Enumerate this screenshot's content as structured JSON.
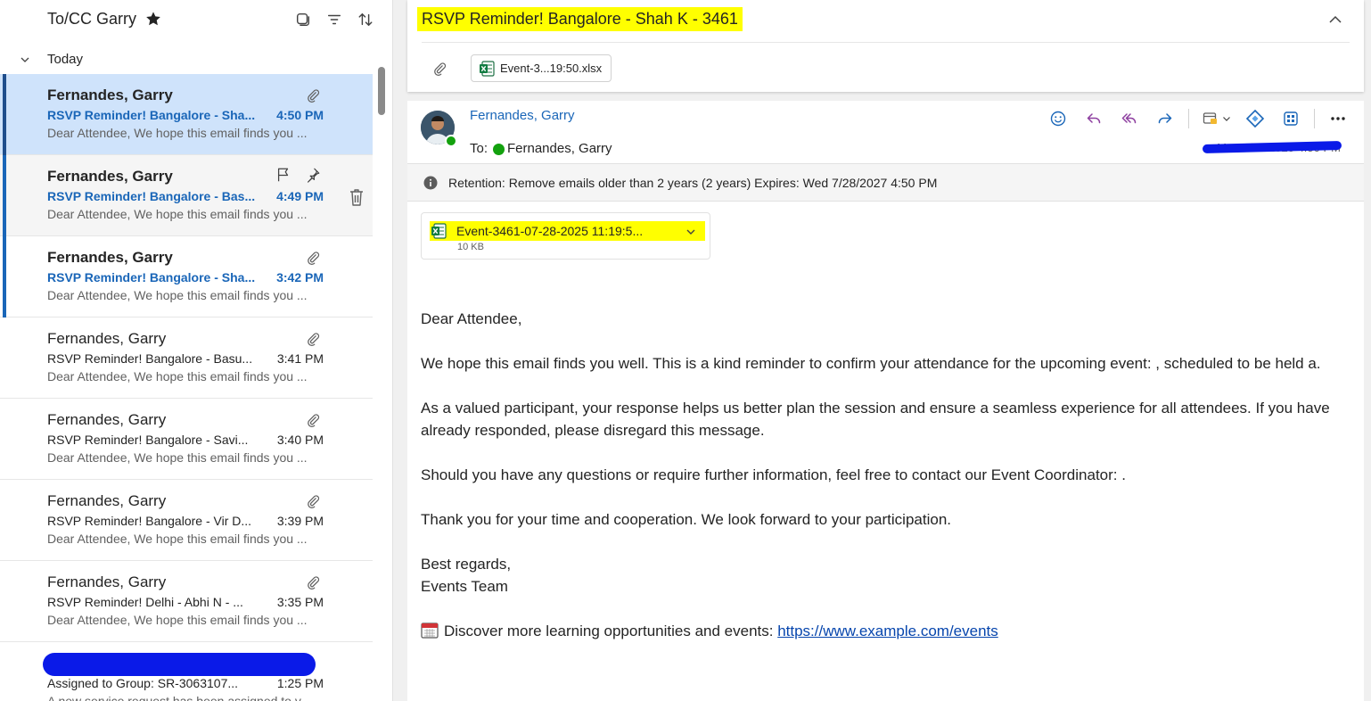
{
  "left_pane": {
    "folder_title": "To/CC Garry",
    "group_label": "Today"
  },
  "messages": [
    {
      "sender": "Fernandes, Garry",
      "subject": "RSVP Reminder! Bangalore - Sha...",
      "time": "4:50 PM",
      "preview": "Dear Attendee, We hope this email finds you ..."
    },
    {
      "sender": "Fernandes, Garry",
      "subject": "RSVP Reminder! Bangalore - Bas...",
      "time": "4:49 PM",
      "preview": "Dear Attendee, We hope this email finds you ..."
    },
    {
      "sender": "Fernandes, Garry",
      "subject": "RSVP Reminder! Bangalore - Sha...",
      "time": "3:42 PM",
      "preview": "Dear Attendee, We hope this email finds you ..."
    },
    {
      "sender": "Fernandes, Garry",
      "subject": "RSVP Reminder! Bangalore - Basu...",
      "time": "3:41 PM",
      "preview": "Dear Attendee, We hope this email finds you ..."
    },
    {
      "sender": "Fernandes, Garry",
      "subject": "RSVP Reminder! Bangalore - Savi...",
      "time": "3:40 PM",
      "preview": "Dear Attendee, We hope this email finds you ..."
    },
    {
      "sender": "Fernandes, Garry",
      "subject": "RSVP Reminder! Bangalore - Vir D...",
      "time": "3:39 PM",
      "preview": "Dear Attendee, We hope this email finds you ..."
    },
    {
      "sender": "Fernandes, Garry",
      "subject": "RSVP Reminder! Delhi - Abhi N - ...",
      "time": "3:35 PM",
      "preview": "Dear Attendee, We hope this email finds you ..."
    },
    {
      "sender": "",
      "subject": "Assigned to Group: SR-3063107...",
      "time": "1:25 PM",
      "preview": "A new service request has been assigned to y..."
    }
  ],
  "reading_pane": {
    "subject": "RSVP Reminder! Bangalore - Shah K - 3461",
    "header_attachment": "Event-3...19:50.xlsx",
    "from": "Fernandes, Garry",
    "to_label": "To:",
    "to_name": "Fernandes, Garry",
    "date": "Mon 7/28/2025 4:50 PM",
    "retention": "Retention: Remove emails older than 2 years (2 years) Expires: Wed 7/28/2027 4:50 PM",
    "attachment": {
      "name": "Event-3461-07-28-2025 11:19:5...",
      "size": "10 KB"
    },
    "body": {
      "greeting": "Dear Attendee,",
      "p1": "We hope this email finds you well. This is a kind reminder to confirm your attendance for the upcoming event: , scheduled to be held a.",
      "p2": "As a valued participant, your response helps us better plan the session and ensure a seamless experience for all attendees. If you have already responded, please disregard this message.",
      "p3": "Should you have any questions or require further information, feel free to contact our Event Coordinator: .",
      "p4": "Thank you for your time and cooperation. We look forward to your participation.",
      "signoff": "Best regards,",
      "team": "Events Team",
      "discover_text": "Discover more learning opportunities and events: ",
      "link": "https://www.example.com/events"
    }
  },
  "colors": {
    "accent": "#1a66b8",
    "highlight": "#ffff00",
    "selected_row": "#cfe3fb",
    "redaction": "#0a1ae8",
    "presence": "#13a10e"
  }
}
